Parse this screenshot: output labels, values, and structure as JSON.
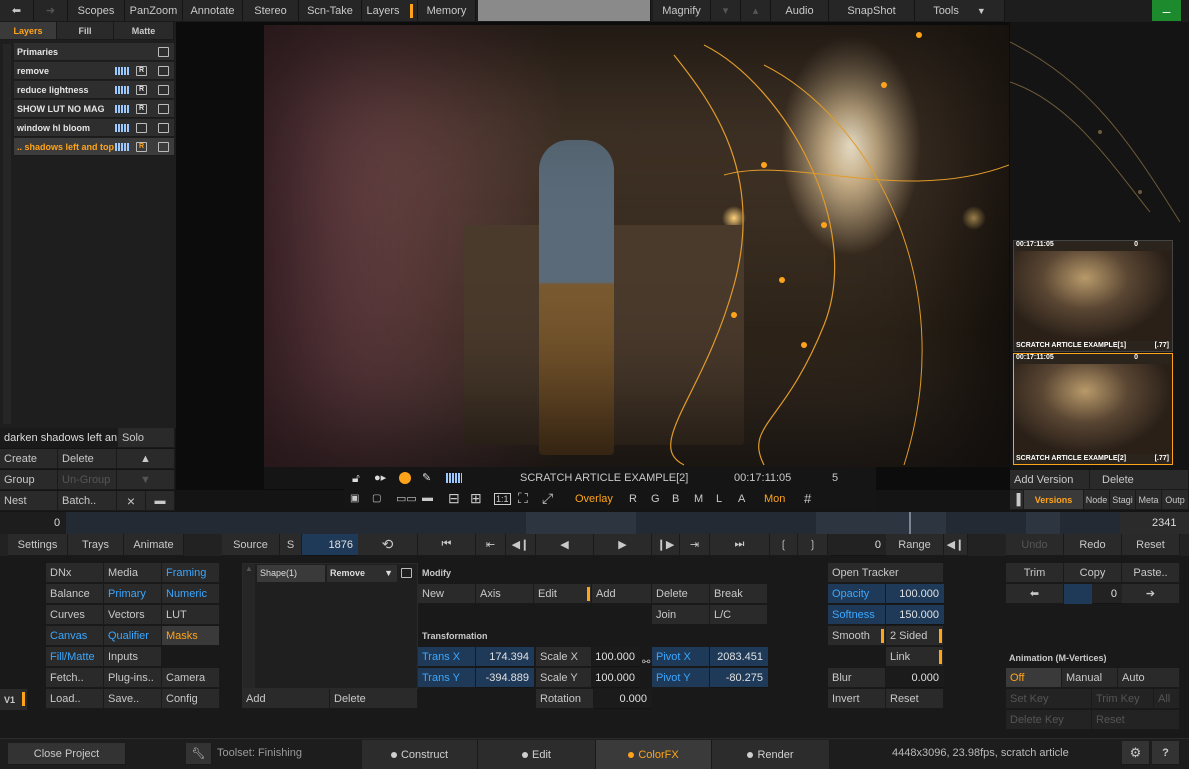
{
  "topbar": {
    "items": [
      "Scopes",
      "PanZoom",
      "Annotate",
      "Stereo",
      "Scn-Take",
      "Layers",
      "Memory"
    ],
    "magnify": "Magnify",
    "audio": "Audio",
    "snapshot": "SnapShot",
    "tools": "Tools",
    "minimize": "–"
  },
  "layer_tabs": [
    "Layers",
    "Fill",
    "Matte"
  ],
  "layers": [
    {
      "name": "Primaries"
    },
    {
      "name": "remove"
    },
    {
      "name": "reduce lightness"
    },
    {
      "name": "SHOW LUT NO MAG"
    },
    {
      "name": "window hl bloom"
    },
    {
      "name": ".. shadows left and top"
    }
  ],
  "layer_panel": {
    "name_field": "darken shadows left and",
    "solo": "Solo",
    "create": "Create",
    "delete": "Delete",
    "group": "Group",
    "ungroup": "Un-Group",
    "nest": "Nest",
    "batch": "Batch..",
    "close": "×"
  },
  "viewer": {
    "title": "SCRATCH ARTICLE EXAMPLE[2]",
    "timecode": "00:17:11:05",
    "count": "5",
    "overlay": "Overlay",
    "channels": [
      "R",
      "G",
      "B",
      "M",
      "L",
      "A"
    ],
    "mon": "Mon",
    "one_to_one": "1:1"
  },
  "versions": [
    {
      "tc": "00:17:11:05",
      "cap": "SCRATCH ARTICLE EXAMPLE[1]",
      "num": "[.77]",
      "badge": "0"
    },
    {
      "tc": "00:17:11:05",
      "cap": "SCRATCH ARTICLE EXAMPLE[2]",
      "num": "[.77]",
      "badge": "0"
    }
  ],
  "version_panel": {
    "add": "Add Version",
    "delete": "Delete",
    "tabs": [
      "Versions",
      "Node",
      "Stagi",
      "Meta",
      "Outp"
    ]
  },
  "timeline": {
    "start": "0",
    "end": "2341",
    "playhead_fraction": 0.8
  },
  "transport": {
    "settings": "Settings",
    "trays": "Trays",
    "animate": "Animate",
    "source": "Source",
    "s": "S",
    "frame": "1876",
    "range_value": "0",
    "range": "Range",
    "undo": "Undo",
    "redo": "Redo",
    "reset": "Reset"
  },
  "menu_grid": [
    [
      "DNx",
      "Media",
      "Framing"
    ],
    [
      "Balance",
      "Primary",
      "Numeric"
    ],
    [
      "Curves",
      "Vectors",
      "LUT"
    ],
    [
      "Canvas",
      "Qualifier",
      "Masks"
    ],
    [
      "Fill/Matte",
      "Inputs",
      ""
    ],
    [
      "Fetch..",
      "Plug-ins..",
      "Camera"
    ],
    [
      "Load..",
      "Save..",
      "Config"
    ]
  ],
  "v1": "V1",
  "shape_panel": {
    "shape": "Shape(1)",
    "mode": "Remove",
    "add": "Add",
    "delete": "Delete"
  },
  "modify": {
    "heading": "Modify",
    "new": "New",
    "axis": "Axis",
    "edit": "Edit",
    "add": "Add",
    "delete": "Delete",
    "break": "Break",
    "join": "Join",
    "lc": "L/C"
  },
  "transformation": {
    "heading": "Transformation",
    "trans_x_label": "Trans X",
    "trans_x": "174.394",
    "trans_y_label": "Trans Y",
    "trans_y": "-394.889",
    "scale_x_label": "Scale X",
    "scale_x": "100.000",
    "scale_y_label": "Scale Y",
    "scale_y": "100.000",
    "rotation_label": "Rotation",
    "rotation": "0.000",
    "pivot_x_label": "Pivot X",
    "pivot_x": "2083.451",
    "pivot_y_label": "Pivot Y",
    "pivot_y": "-80.275"
  },
  "tracker": {
    "open": "Open Tracker",
    "opacity_label": "Opacity",
    "opacity": "100.000",
    "softness_label": "Softness",
    "softness": "150.000",
    "smooth": "Smooth",
    "two_sided": "2 Sided",
    "link": "Link",
    "blur_label": "Blur",
    "blur": "0.000",
    "invert": "Invert",
    "reset": "Reset"
  },
  "trim_panel": {
    "trim": "Trim",
    "copy": "Copy",
    "paste": "Paste..",
    "value": "0"
  },
  "animation": {
    "heading": "Animation (M-Vertices)",
    "off": "Off",
    "manual": "Manual",
    "auto": "Auto",
    "set_key": "Set Key",
    "trim_key": "Trim Key",
    "all": "All",
    "delete_key": "Delete Key",
    "reset": "Reset"
  },
  "footer": {
    "close_project": "Close Project",
    "toolset": "Toolset: Finishing",
    "modes": [
      "Construct",
      "Edit",
      "ColorFX",
      "Render"
    ],
    "info": "4448x3096, 23.98fps, scratch article",
    "help": "?"
  },
  "colors": {
    "accent_orange": "#ffa41a",
    "accent_blue": "#3aa7ff",
    "green": "#1e8a2e"
  }
}
